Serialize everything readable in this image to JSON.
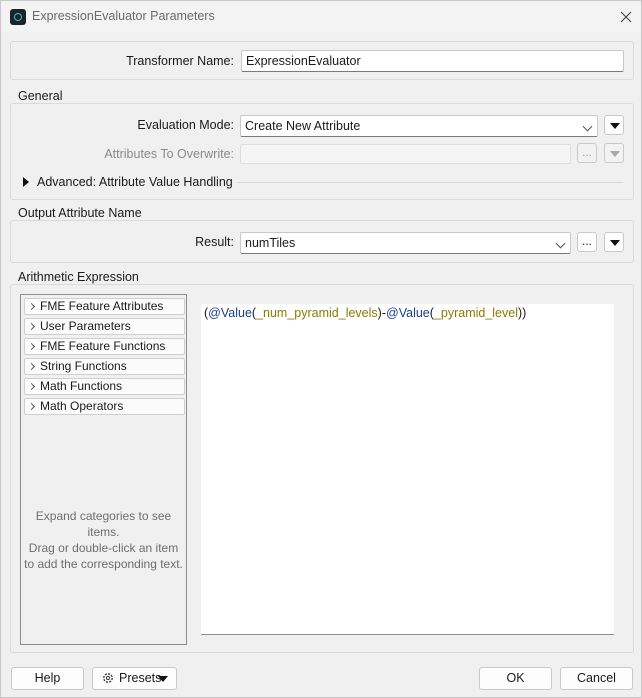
{
  "window": {
    "title": "ExpressionEvaluator Parameters"
  },
  "transformer": {
    "label": "Transformer Name:",
    "value": "ExpressionEvaluator"
  },
  "general": {
    "title": "General",
    "evaluation_mode_label": "Evaluation Mode:",
    "evaluation_mode_value": "Create New Attribute",
    "attributes_overwrite_label": "Attributes To Overwrite:",
    "attributes_overwrite_value": "",
    "ellipsis": "...",
    "advanced_label": "Advanced: Attribute Value Handling"
  },
  "output": {
    "title": "Output Attribute Name",
    "result_label": "Result:",
    "result_value": "numTiles",
    "ellipsis": "..."
  },
  "arithmetic": {
    "title": "Arithmetic Expression",
    "categories": [
      "FME Feature Attributes",
      "User Parameters",
      "FME Feature Functions",
      "String Functions",
      "Math Functions",
      "Math Operators"
    ],
    "hint_lines": [
      "Expand categories to see items.",
      "Drag or double-click an item",
      "to add the corresponding text."
    ],
    "expression": {
      "open_paren": "(",
      "func1": "@Value",
      "paren1_open": "(",
      "attr1": "_num_pyramid_levels",
      "paren1_close": ")",
      "operator": "-",
      "func2": "@Value",
      "paren2_open": "(",
      "attr2": "_pyramid_level",
      "paren2_close": ")",
      "close_paren": ")"
    }
  },
  "footer": {
    "help": "Help",
    "presets": "Presets",
    "ok": "OK",
    "cancel": "Cancel"
  },
  "colors": {
    "function_token": "#1a3e8c",
    "attribute_token": "#8a7a00",
    "app_icon_accent": "#2ec4d6"
  },
  "icons": {
    "app": "fme-app-icon",
    "close": "close-icon",
    "dropdown": "chevron-down-icon",
    "menu": "triangle-down-icon",
    "expand": "triangle-right-icon",
    "category": "chevron-right-icon",
    "presets": "gear-icon"
  }
}
